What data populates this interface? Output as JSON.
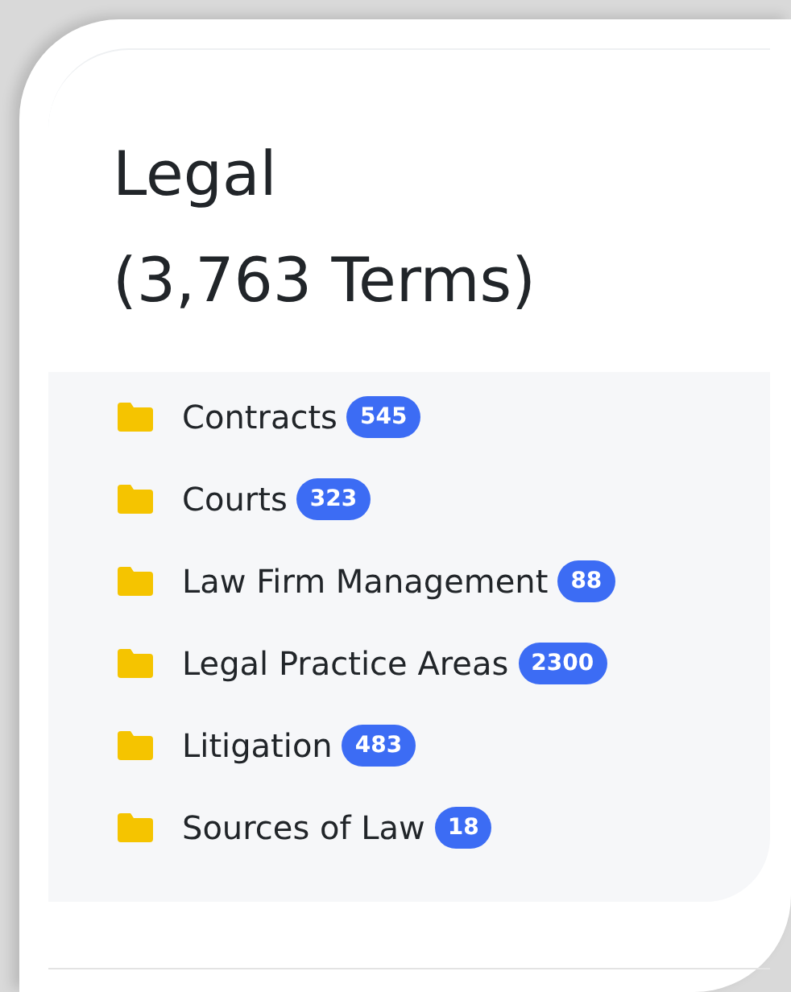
{
  "title_lines": [
    "Legal",
    "(3,763 Terms)"
  ],
  "categories": [
    {
      "label": "Contracts",
      "count": "545"
    },
    {
      "label": "Courts",
      "count": "323"
    },
    {
      "label": "Law Firm Management",
      "count": "88"
    },
    {
      "label": "Legal Practice Areas",
      "count": "2300"
    },
    {
      "label": "Litigation",
      "count": "483"
    },
    {
      "label": "Sources of Law",
      "count": "18"
    }
  ]
}
